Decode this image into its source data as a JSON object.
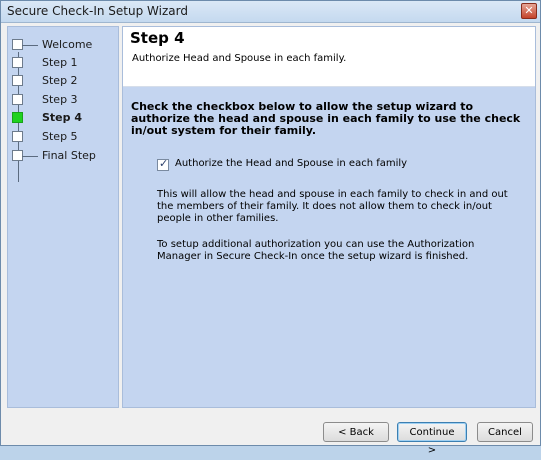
{
  "window": {
    "title": "Secure Check-In Setup Wizard",
    "close_glyph": "✕"
  },
  "steps": [
    {
      "label": "Welcome",
      "active": false
    },
    {
      "label": "Step 1",
      "active": false
    },
    {
      "label": "Step 2",
      "active": false
    },
    {
      "label": "Step 3",
      "active": false
    },
    {
      "label": "Step 4",
      "active": true
    },
    {
      "label": "Step 5",
      "active": false
    },
    {
      "label": "Final Step",
      "active": false
    }
  ],
  "main": {
    "title": "Step 4",
    "subtitle": "Authorize Head and Spouse in each family.",
    "instructions": "Check the checkbox below to allow the setup wizard to authorize the head and spouse in each family to use the check in/out system for their family.",
    "checkbox": {
      "label": "Authorize the Head and Spouse in each family",
      "checked": true
    },
    "para1": "This will allow the head and spouse in each family to check in and out the members of their family. It does not allow them to check in/out people in other families.",
    "para2": "To setup additional authorization you can use the Authorization Manager in Secure Check-In once the setup wizard is finished."
  },
  "buttons": {
    "back": "< Back",
    "continue": "Continue >",
    "cancel": "Cancel"
  },
  "colors": {
    "panel": "#c4d5f0",
    "active_step": "#1fd21f",
    "window_bg": "#f0f0f0"
  }
}
